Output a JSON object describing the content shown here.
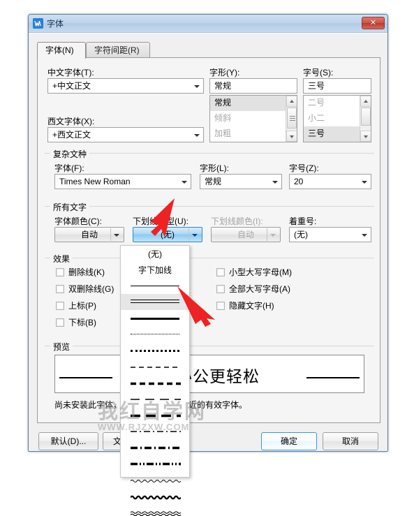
{
  "window": {
    "title": "字体",
    "app_icon": "wps-w-icon",
    "close_label": "✕"
  },
  "tabs": [
    {
      "label": "字体(N)",
      "active": true
    },
    {
      "label": "字符间距(R)",
      "active": false
    }
  ],
  "chinese_font": {
    "label": "中文字体(T):",
    "value": "+中文正文"
  },
  "western_font": {
    "label": "西文字体(X):",
    "value": "+西文正文"
  },
  "font_style": {
    "label": "字形(Y):",
    "value": "常规",
    "options": [
      "常规",
      "倾斜",
      "加粗"
    ],
    "selected_index": 0
  },
  "font_size": {
    "label": "字号(S):",
    "value": "三号",
    "options": [
      "二号",
      "小二",
      "三号"
    ],
    "selected_index": 2
  },
  "complex_script": {
    "group_title": "复杂文种",
    "font": {
      "label": "字体(F):",
      "value": "Times New Roman"
    },
    "style": {
      "label": "字形(L):",
      "value": "常规"
    },
    "size": {
      "label": "字号(Z):",
      "value": "20"
    }
  },
  "all_text": {
    "group_title": "所有文字",
    "font_color": {
      "label": "字体颜色(C):",
      "value": "自动"
    },
    "underline_style": {
      "label": "下划线线型(U):",
      "value": "(无)"
    },
    "underline_color": {
      "label": "下划线颜色(I):",
      "value": "自动",
      "disabled": true
    },
    "emphasis_mark": {
      "label": "着重号:",
      "value": "(无)"
    }
  },
  "effects": {
    "group_title": "效果",
    "left_column": [
      {
        "label": "删除线(K)",
        "checked": false
      },
      {
        "label": "双删除线(G)",
        "checked": false
      },
      {
        "label": "上标(P)",
        "checked": false
      },
      {
        "label": "下标(B)",
        "checked": false
      }
    ],
    "right_column": [
      {
        "label": "小型大写字母(M)",
        "checked": false
      },
      {
        "label": "全部大写字母(A)",
        "checked": false
      },
      {
        "label": "隐藏文字(H)",
        "checked": false
      }
    ]
  },
  "preview": {
    "group_title": "预览",
    "sample_text": "让办公更轻松",
    "note": "尚未安装此字体，打印时将采用最相近的有效字体。"
  },
  "footer": {
    "default_button": "默认(D)...",
    "text_effects_button": "文本效果(E)...",
    "ok_button": "确定",
    "cancel_button": "取消"
  },
  "underline_dropdown": {
    "open": true,
    "selected_index": 3,
    "items": [
      {
        "type": "text",
        "label": "(无)"
      },
      {
        "type": "text",
        "label": "字下加线"
      },
      {
        "type": "line",
        "style": "single"
      },
      {
        "type": "line",
        "style": "double"
      },
      {
        "type": "line",
        "style": "thick"
      },
      {
        "type": "line",
        "style": "dotted-fine"
      },
      {
        "type": "line",
        "style": "dotted-thick"
      },
      {
        "type": "line",
        "style": "dashed-fine"
      },
      {
        "type": "line",
        "style": "dashed-thick"
      },
      {
        "type": "line",
        "style": "long-dash-fine"
      },
      {
        "type": "line",
        "style": "long-dash-thick"
      },
      {
        "type": "line",
        "style": "dash-dot-fine"
      },
      {
        "type": "line",
        "style": "dash-dot-thick"
      },
      {
        "type": "line",
        "style": "dash-dot-dot-thick"
      },
      {
        "type": "line",
        "style": "wave-fine"
      },
      {
        "type": "line",
        "style": "wave-thick"
      },
      {
        "type": "line",
        "style": "wave-double"
      }
    ]
  },
  "annotations": {
    "arrow_color": "#ee2222",
    "arrow_1_target": "underline-style-dropdown-button",
    "arrow_2_target": "underline-double-line-option"
  },
  "watermark": {
    "cn": "我红自学网",
    "en": "WWW.RJZXW.COM"
  },
  "colors": {
    "accent_blue": "#8ec9f0",
    "dialog_bg": "#f0f0f0",
    "panel_bg": "#f5f5f5",
    "close_red": "#cf5446",
    "selection_gray": "#e2e2e2"
  }
}
